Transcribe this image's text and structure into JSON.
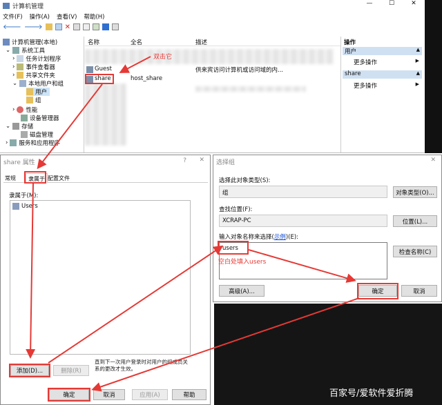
{
  "mmc": {
    "title": "计算机管理",
    "menu": [
      "文件(F)",
      "操作(A)",
      "查看(V)",
      "帮助(H)"
    ],
    "tree": {
      "root": "计算机管理(本地)",
      "system_tools": "系统工具",
      "task_scheduler": "任务计划程序",
      "event_viewer": "事件查看器",
      "shared_folders": "共享文件夹",
      "local_users": "本地用户和组",
      "users": "用户",
      "groups": "组",
      "performance": "性能",
      "device_manager": "设备管理器",
      "storage": "存储",
      "disk_mgmt": "磁盘管理",
      "services": "服务和应用程序"
    },
    "columns": [
      "名称",
      "全名",
      "描述"
    ],
    "rows": [
      {
        "name": "Guest",
        "fullname": "",
        "desc": "供来宾访问计算机或访问域的内..."
      },
      {
        "name": "share",
        "fullname": "host_share",
        "desc": ""
      }
    ],
    "actions": {
      "header": "操作",
      "section1": "用户",
      "more1": "更多操作",
      "section2": "share",
      "more2": "更多操作"
    }
  },
  "annotations": {
    "double_click": "双击它",
    "type_hint": "空白处填入users"
  },
  "props": {
    "title": "share 属性",
    "help_button": "?",
    "tabs": [
      "常规",
      "隶属于",
      "配置文件"
    ],
    "member_of_label": "隶属于(M):",
    "members": [
      "Users"
    ],
    "add": "添加(D)...",
    "remove": "删除(R)",
    "note": "直到下一次用户登录时对用户的组成员关系的更改才生效。",
    "ok": "确定",
    "cancel": "取消",
    "apply": "应用(A)",
    "help": "帮助"
  },
  "select": {
    "title": "选择组",
    "obj_type_label": "选择此对象类型(S):",
    "obj_type_value": "组",
    "obj_type_btn": "对象类型(O)...",
    "location_label": "查找位置(F):",
    "location_value": "XCRAP-PC",
    "location_btn": "位置(L)...",
    "names_label_a": "输入对象名称来选择(",
    "names_label_link": "示例",
    "names_label_b": ")(E):",
    "names_value": "users",
    "check_btn": "检查名称(C)",
    "advanced": "高级(A)...",
    "ok": "确定",
    "cancel": "取消"
  },
  "watermark": "百家号/爱软件爱折腾"
}
